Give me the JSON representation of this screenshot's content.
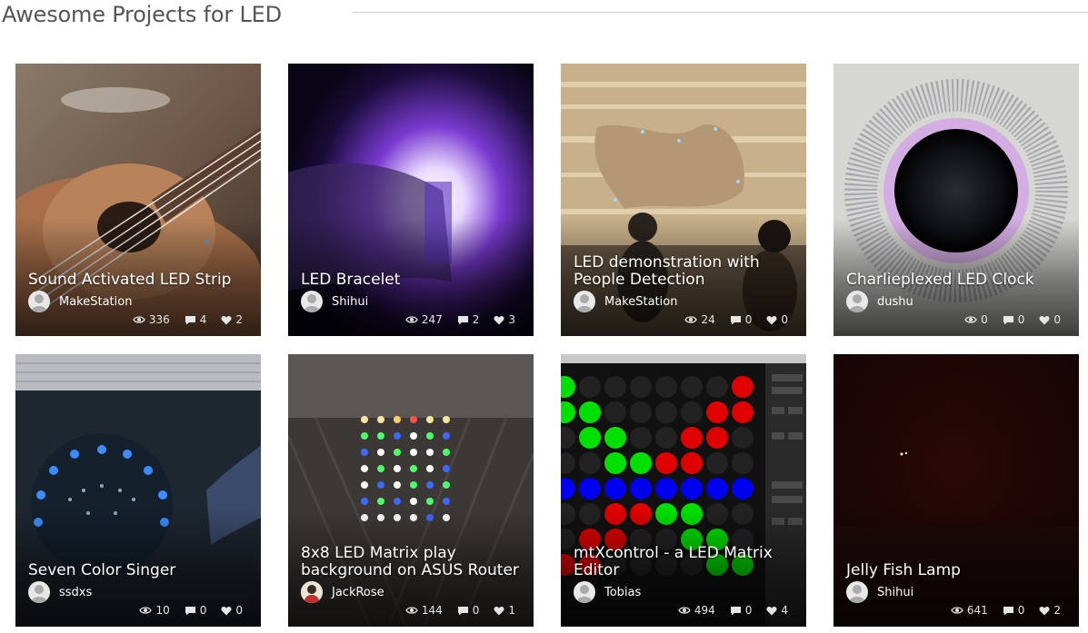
{
  "page": {
    "title": "Awesome Projects for LED"
  },
  "projects": [
    {
      "title": "Sound Activated LED Strip",
      "author": "MakeStation",
      "views": "336",
      "comments": "4",
      "likes": "2"
    },
    {
      "title": "LED Bracelet",
      "author": "Shihui",
      "views": "247",
      "comments": "2",
      "likes": "3"
    },
    {
      "title": "LED demonstration with People Detection",
      "author": "MakeStation",
      "views": "24",
      "comments": "0",
      "likes": "0"
    },
    {
      "title": "Charlieplexed LED Clock",
      "author": "dushu",
      "views": "0",
      "comments": "0",
      "likes": "0"
    },
    {
      "title": "Seven Color Singer",
      "author": "ssdxs",
      "views": "10",
      "comments": "0",
      "likes": "0"
    },
    {
      "title": "8x8 LED Matrix play background on ASUS Router",
      "author": "JackRose",
      "views": "144",
      "comments": "0",
      "likes": "1"
    },
    {
      "title": "mtXcontrol - a LED Matrix Editor",
      "author": "Tobias",
      "views": "494",
      "comments": "0",
      "likes": "4"
    },
    {
      "title": "Jelly Fish Lamp",
      "author": "Shihui",
      "views": "641",
      "comments": "0",
      "likes": "2"
    }
  ]
}
